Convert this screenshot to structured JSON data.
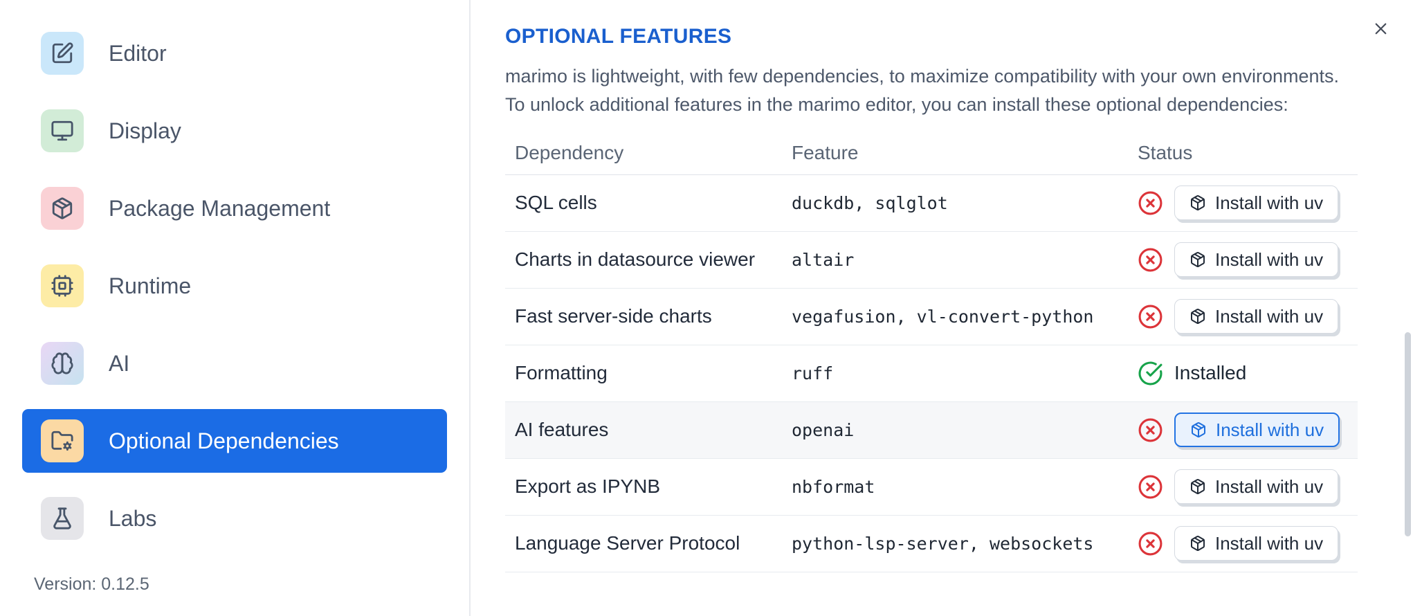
{
  "colors": {
    "accent_blue_selected": "#1b6ce5",
    "title_blue": "#1a5fce",
    "button_highlight_blue": "#1e6fdd",
    "error_red": "#dc3439",
    "success_green": "#17a34a"
  },
  "sidebar": {
    "items": [
      {
        "label": "Editor",
        "icon": "square-pen-icon",
        "selected": false
      },
      {
        "label": "Display",
        "icon": "monitor-icon",
        "selected": false
      },
      {
        "label": "Package Management",
        "icon": "package-icon",
        "selected": false
      },
      {
        "label": "Runtime",
        "icon": "cpu-icon",
        "selected": false
      },
      {
        "label": "AI",
        "icon": "brain-icon",
        "selected": false
      },
      {
        "label": "Optional Dependencies",
        "icon": "folder-cog-icon",
        "selected": true
      },
      {
        "label": "Labs",
        "icon": "flask-icon",
        "selected": false
      }
    ],
    "version_label": "Version: 0.12.5"
  },
  "panel": {
    "title": "OPTIONAL FEATURES",
    "description_line1": "marimo is lightweight, with few dependencies, to maximize compatibility with your own environments.",
    "description_line2": "To unlock additional features in the marimo editor, you can install these optional dependencies:",
    "close_icon": "close-icon"
  },
  "table": {
    "headers": [
      "Dependency",
      "Feature",
      "Status"
    ],
    "rows": [
      {
        "dependency": "SQL cells",
        "feature": "duckdb, sqlglot",
        "installed": false,
        "button_label": "Install with uv",
        "highlighted": false
      },
      {
        "dependency": "Charts in datasource viewer",
        "feature": "altair",
        "installed": false,
        "button_label": "Install with uv",
        "highlighted": false
      },
      {
        "dependency": "Fast server-side charts",
        "feature": "vegafusion, vl-convert-python",
        "installed": false,
        "button_label": "Install with uv",
        "highlighted": false
      },
      {
        "dependency": "Formatting",
        "feature": "ruff",
        "installed": true,
        "status_text": "Installed",
        "highlighted": false
      },
      {
        "dependency": "AI features",
        "feature": "openai",
        "installed": false,
        "button_label": "Install with uv",
        "highlighted": true
      },
      {
        "dependency": "Export as IPYNB",
        "feature": "nbformat",
        "installed": false,
        "button_label": "Install with uv",
        "highlighted": false
      },
      {
        "dependency": "Language Server Protocol",
        "feature": "python-lsp-server, websockets",
        "installed": false,
        "button_label": "Install with uv",
        "highlighted": false
      }
    ]
  }
}
